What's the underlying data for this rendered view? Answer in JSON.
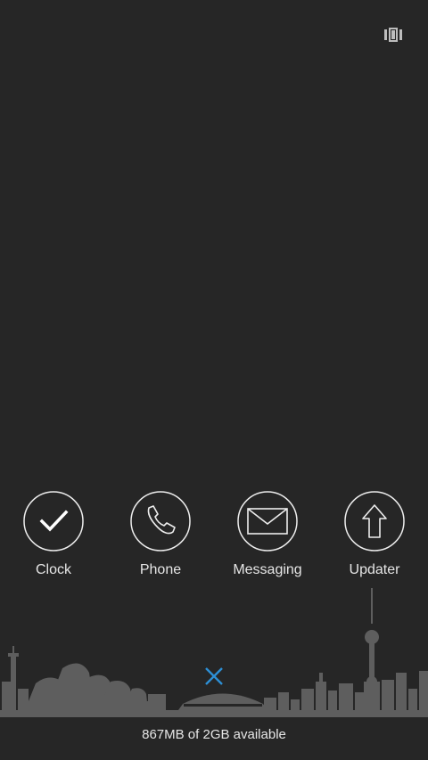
{
  "header": {
    "recents_icon": "recents-layout-icon"
  },
  "apps": [
    {
      "label": "Clock",
      "icon": "check-icon"
    },
    {
      "label": "Phone",
      "icon": "phone-icon"
    },
    {
      "label": "Messaging",
      "icon": "envelope-icon"
    },
    {
      "label": "Updater",
      "icon": "up-arrow-icon"
    }
  ],
  "close_button": {
    "icon": "close-icon",
    "color": "#2d8fd5"
  },
  "footer": {
    "storage_text": "867MB of 2GB available"
  },
  "colors": {
    "background": "#262626",
    "skyline": "#5e5e5e",
    "text": "#e6e6e6",
    "accent": "#2d8fd5"
  }
}
